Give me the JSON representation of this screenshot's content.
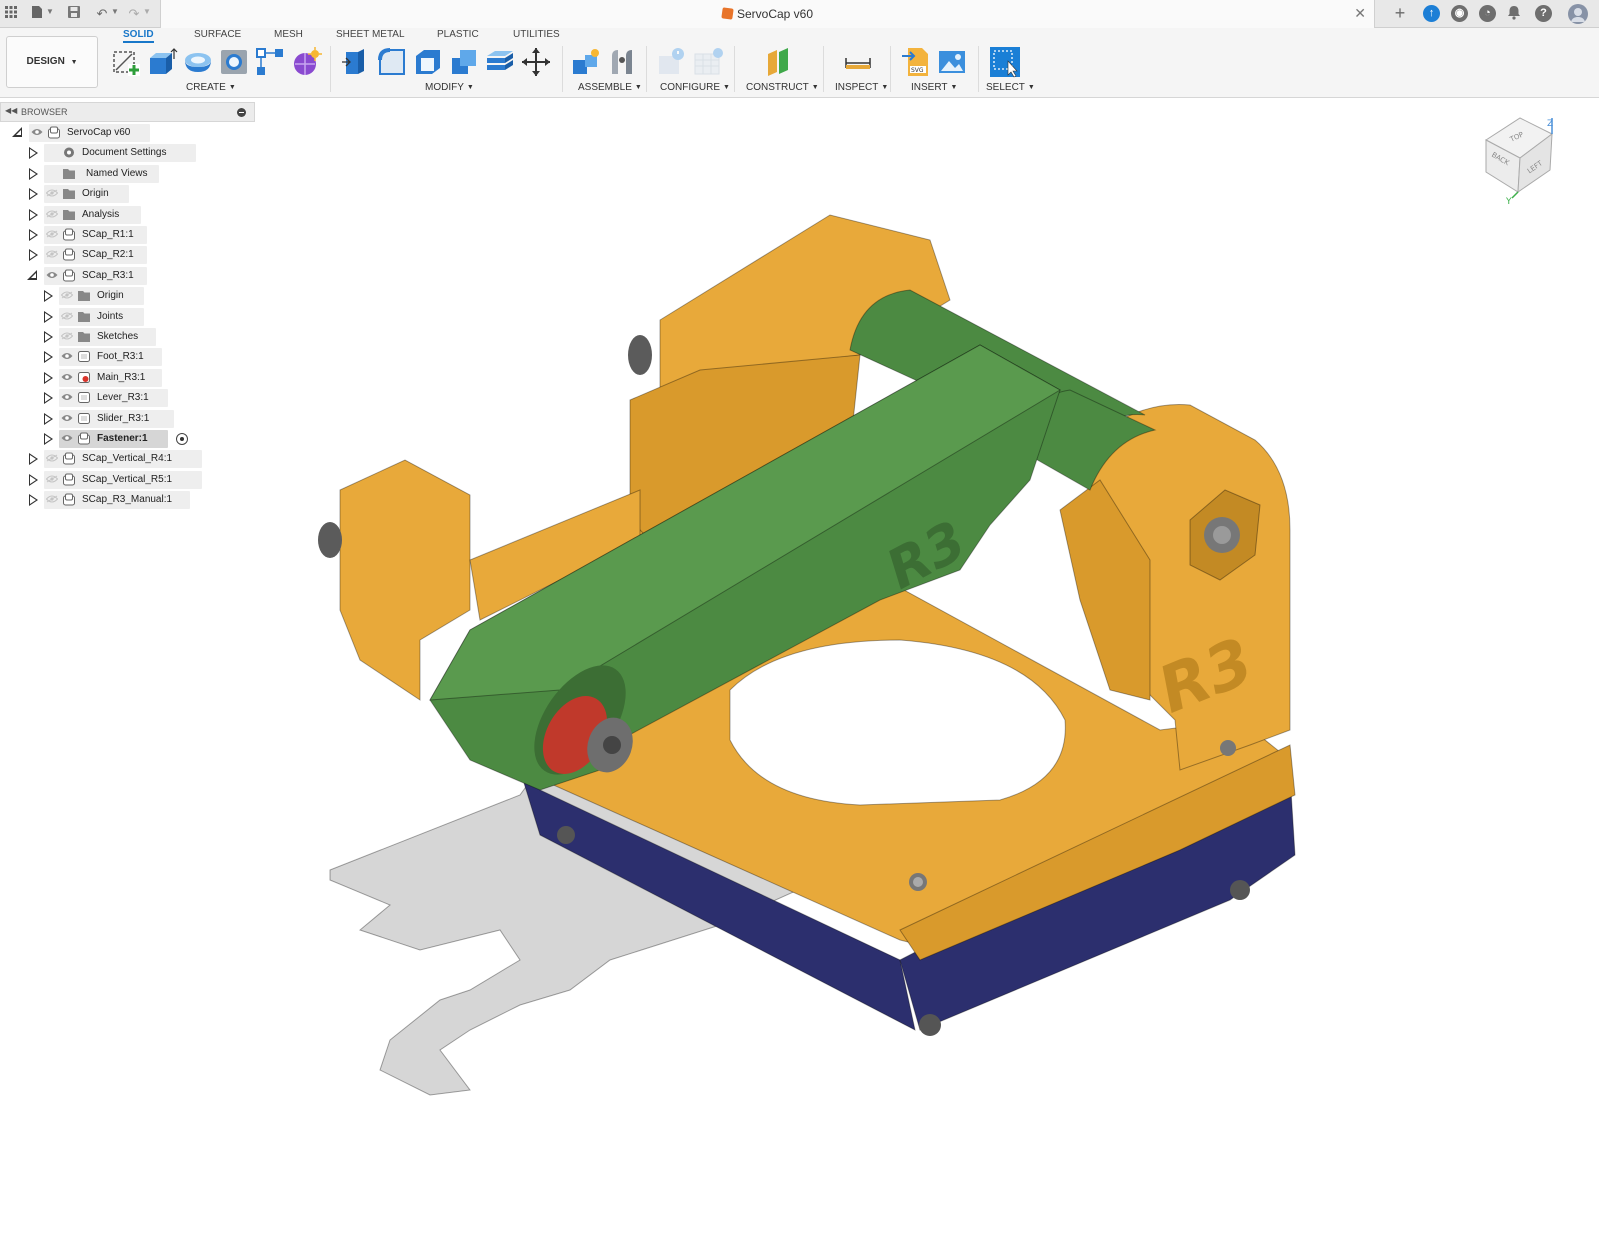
{
  "window": {
    "document_title": "ServoCap v60"
  },
  "ribbon": {
    "workspace_button": "DESIGN",
    "tabs": [
      {
        "label": "SOLID",
        "active": true
      },
      {
        "label": "SURFACE",
        "active": false
      },
      {
        "label": "MESH",
        "active": false
      },
      {
        "label": "SHEET METAL",
        "active": false
      },
      {
        "label": "PLASTIC",
        "active": false
      },
      {
        "label": "UTILITIES",
        "active": false
      }
    ],
    "groups": {
      "create": "CREATE",
      "modify": "MODIFY",
      "assemble": "ASSEMBLE",
      "configure": "CONFIGURE",
      "construct": "CONSTRUCT",
      "inspect": "INSPECT",
      "insert": "INSERT",
      "select": "SELECT"
    }
  },
  "browser": {
    "title": "BROWSER",
    "items": [
      {
        "label": "ServoCap v60",
        "level": 0,
        "expanded": true,
        "icon": "component-icon",
        "visible_eye": true
      },
      {
        "label": "Document Settings",
        "level": 1,
        "expanded": false,
        "icon": "gear-icon",
        "visible_eye": false
      },
      {
        "label": "Named Views",
        "level": 1,
        "expanded": false,
        "icon": "folder-icon",
        "visible_eye": false
      },
      {
        "label": "Origin",
        "level": 1,
        "expanded": false,
        "icon": "folder-icon",
        "visible_eye": true,
        "hidden": true
      },
      {
        "label": "Analysis",
        "level": 1,
        "expanded": false,
        "icon": "folder-icon",
        "visible_eye": true,
        "hidden": true
      },
      {
        "label": "SCap_R1:1",
        "level": 1,
        "expanded": false,
        "icon": "component-icon",
        "visible_eye": true,
        "hidden": true
      },
      {
        "label": "SCap_R2:1",
        "level": 1,
        "expanded": false,
        "icon": "component-icon",
        "visible_eye": true,
        "hidden": true
      },
      {
        "label": "SCap_R3:1",
        "level": 1,
        "expanded": true,
        "icon": "component-icon",
        "visible_eye": true
      },
      {
        "label": "Origin",
        "level": 2,
        "expanded": false,
        "icon": "folder-icon",
        "visible_eye": true,
        "hidden": true
      },
      {
        "label": "Joints",
        "level": 2,
        "expanded": false,
        "icon": "folder-icon",
        "visible_eye": true,
        "hidden": true
      },
      {
        "label": "Sketches",
        "level": 2,
        "expanded": false,
        "icon": "folder-icon",
        "visible_eye": true,
        "hidden": true
      },
      {
        "label": "Foot_R3:1",
        "level": 2,
        "expanded": false,
        "icon": "body-component-icon",
        "visible_eye": true
      },
      {
        "label": "Main_R3:1",
        "level": 2,
        "expanded": false,
        "icon": "body-component-warning-icon",
        "visible_eye": true
      },
      {
        "label": "Lever_R3:1",
        "level": 2,
        "expanded": false,
        "icon": "body-component-icon",
        "visible_eye": true
      },
      {
        "label": "Slider_R3:1",
        "level": 2,
        "expanded": false,
        "icon": "body-component-icon",
        "visible_eye": true
      },
      {
        "label": "Fastener:1",
        "level": 2,
        "expanded": false,
        "icon": "component-icon",
        "visible_eye": true,
        "selected": true,
        "active_target": true
      },
      {
        "label": "SCap_Vertical_R4:1",
        "level": 1,
        "expanded": false,
        "icon": "component-icon",
        "visible_eye": true,
        "hidden": true
      },
      {
        "label": "SCap_Vertical_R5:1",
        "level": 1,
        "expanded": false,
        "icon": "component-icon",
        "visible_eye": true,
        "hidden": true
      },
      {
        "label": "SCap_R3_Manual:1",
        "level": 1,
        "expanded": false,
        "icon": "component-icon",
        "visible_eye": true,
        "hidden": true
      }
    ]
  },
  "viewport": {
    "viewcube_faces": [
      "TOP",
      "BACK",
      "LEFT"
    ],
    "axis_labels": [
      "Z",
      "Y"
    ],
    "part_engravings": [
      "R3",
      "R3"
    ],
    "colors": {
      "main_body": "#e8a93a",
      "lever": "#5a9a4e",
      "foot": "#2c2f6e",
      "slider": "#c0392b",
      "fastener": "#6e6e6e",
      "shadow": "#d6d6d6"
    }
  }
}
